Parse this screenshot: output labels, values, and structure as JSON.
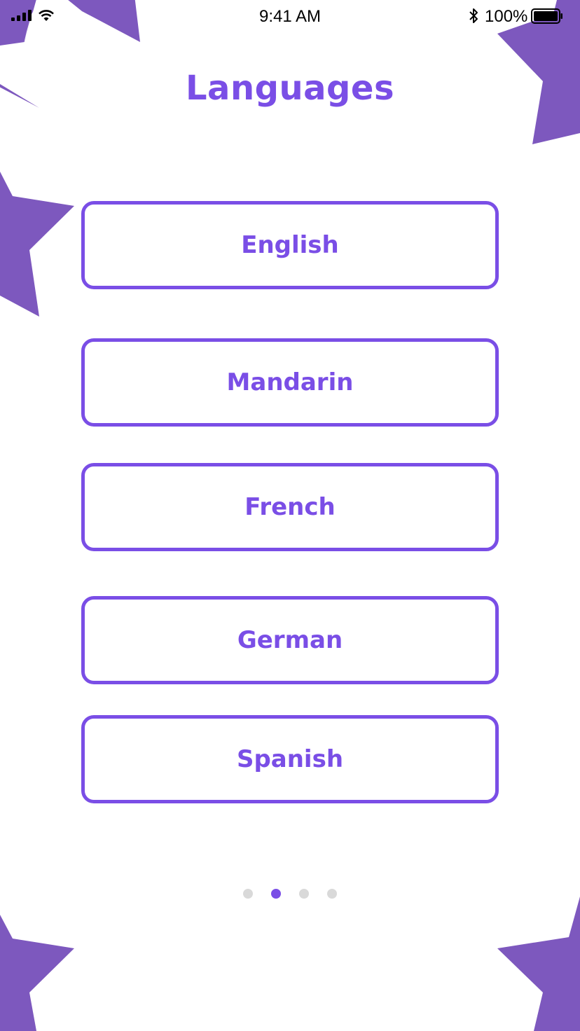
{
  "status_bar": {
    "time": "9:41 AM",
    "battery_percent": "100%",
    "icons": [
      "signal-bars-icon",
      "wifi-icon",
      "bluetooth-icon",
      "battery-icon"
    ]
  },
  "title": "Languages",
  "languages": [
    {
      "label": "English"
    },
    {
      "label": "Mandarin"
    },
    {
      "label": "French"
    },
    {
      "label": "German"
    },
    {
      "label": "Spanish"
    }
  ],
  "pagination": {
    "total": 4,
    "active_index": 1
  },
  "colors": {
    "accent": "#7a4ee6",
    "star": "#7d58be",
    "dot_inactive": "#d9d9d9",
    "background": "#ffffff"
  }
}
